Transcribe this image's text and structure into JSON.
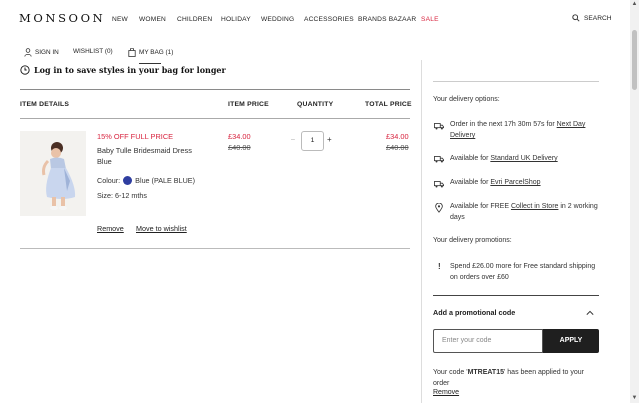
{
  "header": {
    "logo": "MONSOON",
    "nav": [
      {
        "label": "NEW"
      },
      {
        "label": "WOMEN"
      },
      {
        "label": "CHILDREN"
      },
      {
        "label": "HOLIDAY"
      },
      {
        "label": "WEDDING"
      },
      {
        "label": "ACCESSORIES"
      },
      {
        "label": "BRANDS BAZAAR"
      },
      {
        "label": "SALE"
      }
    ],
    "search_label": "SEARCH",
    "sign_in": "SIGN IN",
    "wishlist": "WISHLIST (0)",
    "bag": "MY BAG (1)"
  },
  "bag": {
    "login_message": "Log in to save styles in your bag for longer",
    "columns": {
      "details": "ITEM DETAILS",
      "price": "ITEM PRICE",
      "quantity": "QUANTITY",
      "total": "TOTAL PRICE"
    },
    "item": {
      "promo": "15% OFF FULL PRICE",
      "name": "Baby Tulle Bridesmaid Dress Blue",
      "colour_label": "Colour:",
      "colour_value": "Blue (PALE BLUE)",
      "colour_hex": "#2f3ea0",
      "size": "Size: 6-12 mths",
      "price_now": "£34.00",
      "price_was": "£40.00",
      "qty": "1",
      "qty_minus": "–",
      "qty_plus": "+",
      "total_now": "£34.00",
      "total_was": "£40.00",
      "remove": "Remove",
      "move_to_wishlist": "Move to wishlist"
    }
  },
  "delivery": {
    "title": "Your delivery options:",
    "next_day_pre": "Order in the next 17h 30m 57s for ",
    "next_day_link": "Next Day Delivery",
    "standard_pre": "Available for ",
    "standard_link": "Standard UK Delivery",
    "evri_pre": "Available for ",
    "evri_link": "Evri ParcelShop",
    "collect_pre": "Available for FREE ",
    "collect_link": "Collect in Store",
    "collect_post": " in 2 working days",
    "promotions_title": "Your delivery promotions:",
    "promotion_text": "Spend £26.00 more for Free standard shipping on orders over £60"
  },
  "promo_code": {
    "title": "Add a promotional code",
    "placeholder": "Enter your code",
    "apply": "APPLY",
    "applied_pre": "Your code '",
    "applied_code": "MTREAT15",
    "applied_post": "' has been applied to your order",
    "remove": "Remove"
  }
}
